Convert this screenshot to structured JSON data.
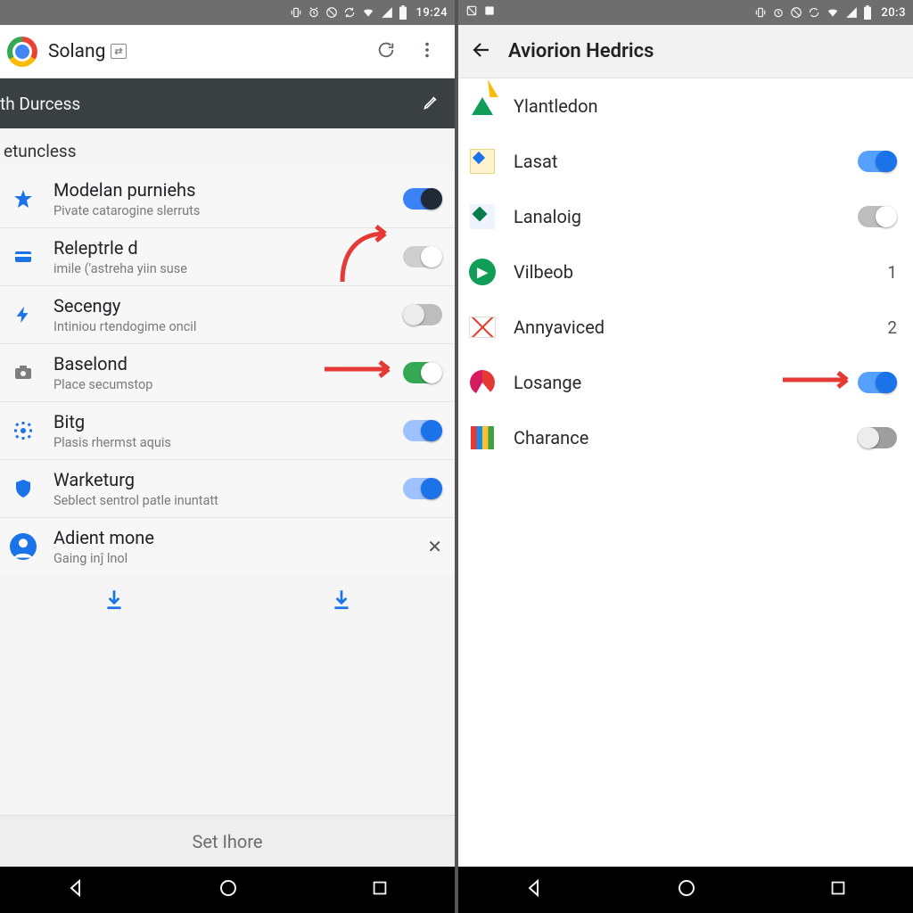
{
  "left": {
    "status": {
      "time": "19:24"
    },
    "header": {
      "title": "Solang"
    },
    "dark_sub": {
      "label": "th Durcess"
    },
    "section_label": "etuncless",
    "items": [
      {
        "icon_name": "star-icon",
        "title": "Modelan purniehs",
        "sub": "Pivate catarogine slerruts",
        "toggle": "on-bluedark"
      },
      {
        "icon_name": "card-icon",
        "title": "Releptrle d",
        "sub": "imile ('astreha yiin suse",
        "toggle": "off-white"
      },
      {
        "icon_name": "bolt-icon",
        "title": "Secengy",
        "sub": "Intiniou rtendogime oncil",
        "toggle": "off-gray"
      },
      {
        "icon_name": "camera-icon",
        "title": "Baselond",
        "sub": "Place secumstop",
        "toggle": "on-green"
      },
      {
        "icon_name": "gear-icon",
        "title": "Bitg",
        "sub": "Plasis rhermst aquis",
        "toggle": "on-blue"
      },
      {
        "icon_name": "shield-icon",
        "title": "Warketurg",
        "sub": "Seblect sentrol patle inuntatt",
        "toggle": "on-blue"
      },
      {
        "icon_name": "person-icon",
        "title": "Adient mone",
        "sub": "Gaing inĵ lnol",
        "toggle": null,
        "close": true
      }
    ],
    "footer_button": "Set Ihore"
  },
  "right": {
    "status": {
      "time": "20:3"
    },
    "header": {
      "title": "Aviorion Hedrics"
    },
    "items": [
      {
        "icon_name": "drive-icon",
        "label": "Ylantledon",
        "value": "",
        "toggle": null
      },
      {
        "icon_name": "maps-icon",
        "label": "Lasat",
        "value": "",
        "toggle": "on-blue2"
      },
      {
        "icon_name": "landloig-icon",
        "label": "Lanaloig",
        "value": "",
        "toggle": "off-graywhite"
      },
      {
        "icon_name": "play-icon",
        "label": "Vilbeob",
        "value": "1",
        "toggle": null
      },
      {
        "icon_name": "gmail-icon",
        "label": "Annyaviced",
        "value": "2",
        "toggle": null
      },
      {
        "icon_name": "pie-icon",
        "label": "Losange",
        "value": "",
        "toggle": "on-blue2"
      },
      {
        "icon_name": "bars-icon",
        "label": "Charance",
        "value": "",
        "toggle": "off-dark"
      }
    ]
  }
}
